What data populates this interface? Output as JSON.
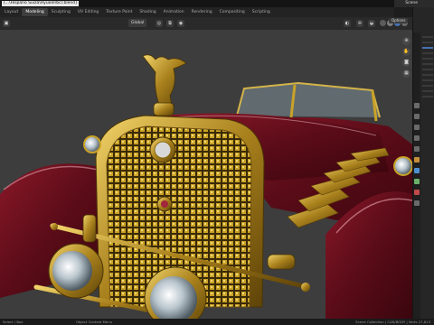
{
  "window": {
    "title": "[...\\Hispano Suiza\\Hyuoelrbcr.blend]",
    "scene": "Scene"
  },
  "workspace_tabs": [
    {
      "label": "Layout",
      "active": false
    },
    {
      "label": "Modeling",
      "active": true
    },
    {
      "label": "Sculpting",
      "active": false
    },
    {
      "label": "UV Editing",
      "active": false
    },
    {
      "label": "Texture Paint",
      "active": false
    },
    {
      "label": "Shading",
      "active": false
    },
    {
      "label": "Animation",
      "active": false
    },
    {
      "label": "Rendering",
      "active": false
    },
    {
      "label": "Compositing",
      "active": false
    },
    {
      "label": "Scripting",
      "active": false
    }
  ],
  "viewport_header": {
    "transform_orientation": "Global",
    "options_label": "Options"
  },
  "statusbar": {
    "left": "Select / Box",
    "middle": "Object Context Menu",
    "right": "Scene Collection | CAR/BODY | Verts 27,813"
  },
  "colors": {
    "accent": "#4772b3",
    "car_paint": "#6b1020",
    "gold": "#c9a227"
  },
  "icons": [
    "cursor-icon",
    "hand-icon",
    "zoom-icon",
    "camera-icon",
    "grid-icon",
    "filter-icon"
  ]
}
